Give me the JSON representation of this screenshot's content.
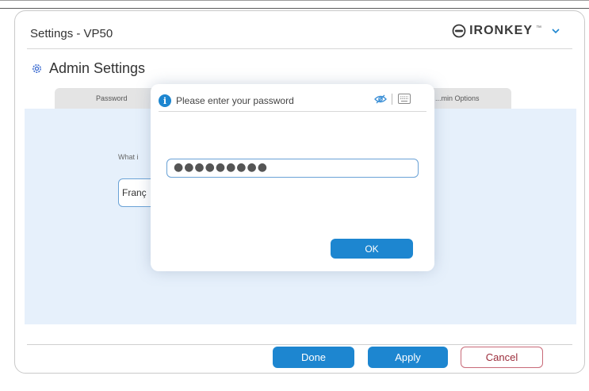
{
  "window": {
    "title": "Settings - VP50"
  },
  "brand": {
    "logo_text": "IRONKEY",
    "trademark": "™"
  },
  "page": {
    "title": "Admin Settings"
  },
  "tabs": [
    {
      "label": "Password"
    },
    {
      "label": "...min Options"
    }
  ],
  "content": {
    "question": "What i",
    "language_value": "Franç"
  },
  "dialog": {
    "title": "Please enter your password",
    "password_masked": "●●●●●●●●●",
    "ok_label": "OK"
  },
  "footer": {
    "done_label": "Done",
    "apply_label": "Apply",
    "cancel_label": "Cancel"
  },
  "colors": {
    "accent": "#1d86d0",
    "content_bg": "#e6f0fb",
    "cancel_text": "#9b2c3a"
  },
  "icons": [
    "ironkey-logo-icon",
    "chevron-down-icon",
    "gear-icon",
    "info-icon",
    "eye-icon",
    "keyboard-icon"
  ]
}
